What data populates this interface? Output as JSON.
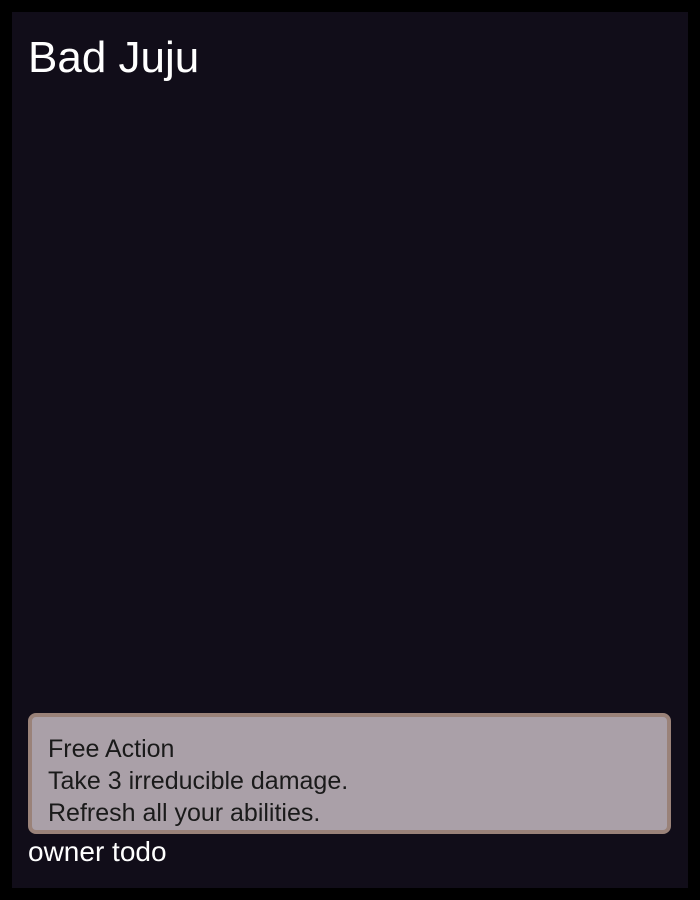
{
  "card": {
    "title": "Bad Juju",
    "ability": {
      "type": "Free Action",
      "lines": [
        "Take 3 irreducible damage.",
        "Refresh all your abilities."
      ]
    },
    "owner": "owner todo"
  },
  "colors": {
    "page_background": "#000000",
    "card_background": "#110d19",
    "title_text": "#ffffff",
    "ability_background": "#aaa0a8",
    "ability_border": "#9a8279",
    "ability_text": "#1a1a1a",
    "owner_text": "#ffffff"
  }
}
